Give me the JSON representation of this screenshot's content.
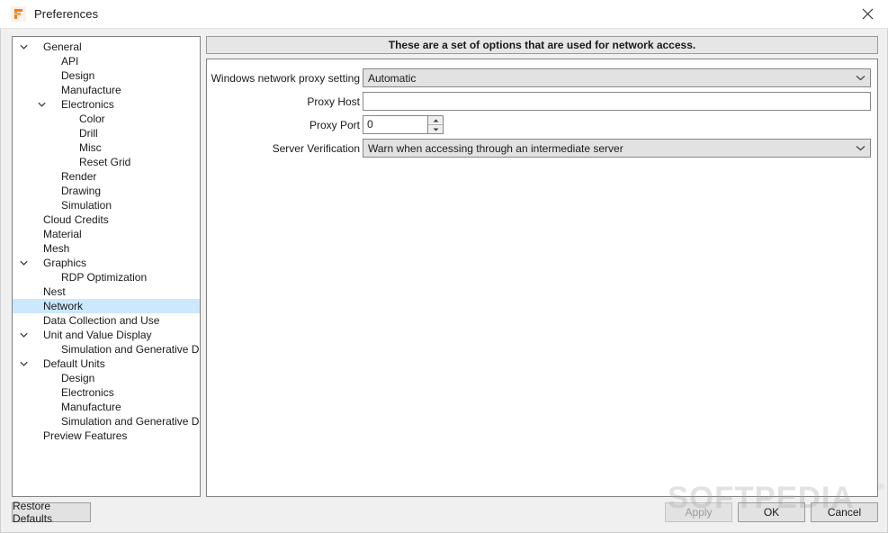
{
  "window": {
    "title": "Preferences",
    "icon": "fusion-f-icon",
    "close_label": "Close"
  },
  "sidebar": {
    "items": [
      {
        "label": "General",
        "level": 0,
        "expandable": true,
        "expanded": true,
        "selected": false
      },
      {
        "label": "API",
        "level": 1,
        "expandable": false,
        "expanded": false,
        "selected": false
      },
      {
        "label": "Design",
        "level": 1,
        "expandable": false,
        "expanded": false,
        "selected": false
      },
      {
        "label": "Manufacture",
        "level": 1,
        "expandable": false,
        "expanded": false,
        "selected": false
      },
      {
        "label": "Electronics",
        "level": 1,
        "expandable": true,
        "expanded": true,
        "selected": false
      },
      {
        "label": "Color",
        "level": 2,
        "expandable": false,
        "expanded": false,
        "selected": false
      },
      {
        "label": "Drill",
        "level": 2,
        "expandable": false,
        "expanded": false,
        "selected": false
      },
      {
        "label": "Misc",
        "level": 2,
        "expandable": false,
        "expanded": false,
        "selected": false
      },
      {
        "label": "Reset Grid",
        "level": 2,
        "expandable": false,
        "expanded": false,
        "selected": false
      },
      {
        "label": "Render",
        "level": 1,
        "expandable": false,
        "expanded": false,
        "selected": false
      },
      {
        "label": "Drawing",
        "level": 1,
        "expandable": false,
        "expanded": false,
        "selected": false
      },
      {
        "label": "Simulation",
        "level": 1,
        "expandable": false,
        "expanded": false,
        "selected": false
      },
      {
        "label": "Cloud Credits",
        "level": 0,
        "expandable": false,
        "expanded": false,
        "selected": false
      },
      {
        "label": "Material",
        "level": 0,
        "expandable": false,
        "expanded": false,
        "selected": false
      },
      {
        "label": "Mesh",
        "level": 0,
        "expandable": false,
        "expanded": false,
        "selected": false
      },
      {
        "label": "Graphics",
        "level": 0,
        "expandable": true,
        "expanded": true,
        "selected": false
      },
      {
        "label": "RDP Optimization",
        "level": 1,
        "expandable": false,
        "expanded": false,
        "selected": false
      },
      {
        "label": "Nest",
        "level": 0,
        "expandable": false,
        "expanded": false,
        "selected": false
      },
      {
        "label": "Network",
        "level": 0,
        "expandable": false,
        "expanded": false,
        "selected": true
      },
      {
        "label": "Data Collection and Use",
        "level": 0,
        "expandable": false,
        "expanded": false,
        "selected": false
      },
      {
        "label": "Unit and Value Display",
        "level": 0,
        "expandable": true,
        "expanded": true,
        "selected": false
      },
      {
        "label": "Simulation and Generative Design",
        "level": 1,
        "expandable": false,
        "expanded": false,
        "selected": false
      },
      {
        "label": "Default Units",
        "level": 0,
        "expandable": true,
        "expanded": true,
        "selected": false
      },
      {
        "label": "Design",
        "level": 1,
        "expandable": false,
        "expanded": false,
        "selected": false
      },
      {
        "label": "Electronics",
        "level": 1,
        "expandable": false,
        "expanded": false,
        "selected": false
      },
      {
        "label": "Manufacture",
        "level": 1,
        "expandable": false,
        "expanded": false,
        "selected": false
      },
      {
        "label": "Simulation and Generative Design",
        "level": 1,
        "expandable": false,
        "expanded": false,
        "selected": false
      },
      {
        "label": "Preview Features",
        "level": 0,
        "expandable": false,
        "expanded": false,
        "selected": false
      }
    ]
  },
  "content": {
    "banner": "These are a set of options that are used for network access.",
    "fields": {
      "proxy_setting": {
        "label": "Windows network proxy setting",
        "value": "Automatic",
        "options": [
          "Automatic"
        ]
      },
      "proxy_host": {
        "label": "Proxy Host",
        "value": "",
        "placeholder": ""
      },
      "proxy_port": {
        "label": "Proxy Port",
        "value": "0"
      },
      "server_verification": {
        "label": "Server Verification",
        "value": "Warn when accessing through an intermediate server",
        "options": [
          "Warn when accessing through an intermediate server"
        ]
      }
    }
  },
  "footer": {
    "restore_defaults": "Restore Defaults",
    "apply": "Apply",
    "apply_enabled": false,
    "ok": "OK",
    "cancel": "Cancel"
  },
  "watermark": {
    "text": "SOFTPEDIA",
    "registered": "®"
  },
  "colors": {
    "selection": "#cce8ff",
    "accent": "#f07d28",
    "window_bg": "#f0f0f0",
    "panel_bg": "#ffffff",
    "control_bg": "#e2e2e2"
  }
}
